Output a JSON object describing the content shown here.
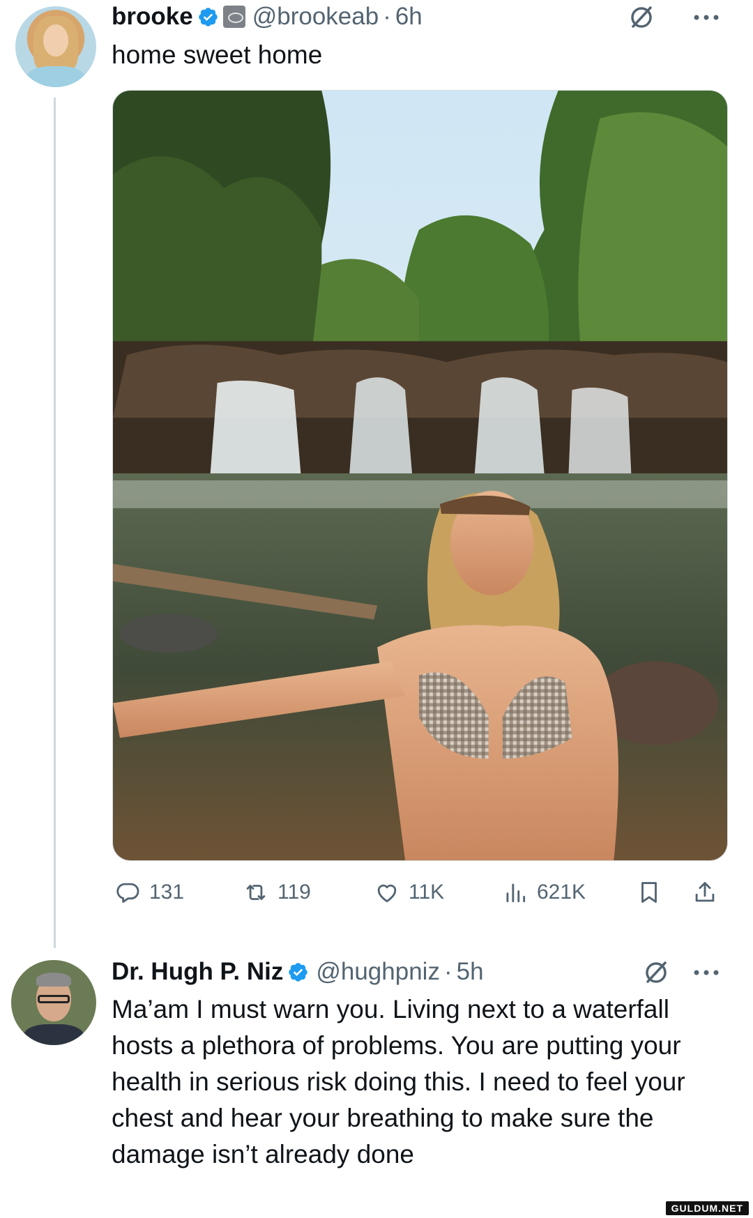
{
  "tweets": [
    {
      "display_name": "brooke",
      "handle": "@brookeab",
      "separator": "·",
      "time": "6h",
      "text": "home sweet home",
      "stats": {
        "replies": "131",
        "retweets": "119",
        "likes": "11K",
        "views": "621K"
      }
    },
    {
      "display_name": "Dr. Hugh P. Niz",
      "handle": "@hughpniz",
      "separator": "·",
      "time": "5h",
      "text": "Ma’am I must warn you. Living next to a waterfall hosts a plethora of problems. You are putting your health in serious risk doing this. I need to feel your chest and hear your breathing to make sure the damage isn’t already done"
    }
  ],
  "watermark": "GULDUM.NET",
  "colors": {
    "verified": "#1d9bf0",
    "text_primary": "#0f1419",
    "text_secondary": "#536471",
    "thread_line": "#cfd9de"
  },
  "icons": [
    "verified-badge-icon",
    "affiliate-badge-icon",
    "grok-icon",
    "more-icon",
    "reply-icon",
    "retweet-icon",
    "like-icon",
    "views-icon",
    "bookmark-icon",
    "share-icon"
  ]
}
